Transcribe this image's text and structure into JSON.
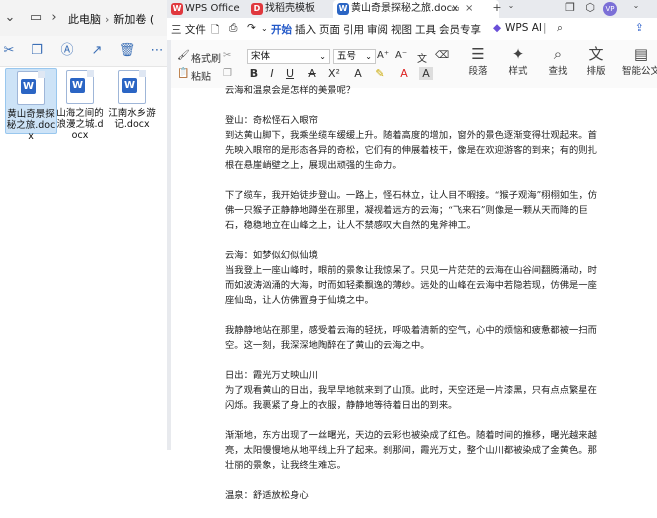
{
  "explorer": {
    "breadcrumb": [
      "此电脑",
      "新加卷 ("
    ],
    "files": [
      {
        "name": "黄山奇景探秘之旅.docx",
        "selected": true
      },
      {
        "name": "山海之间的浪漫之城.docx",
        "selected": false
      },
      {
        "name": "江南水乡游记.docx",
        "selected": false
      }
    ]
  },
  "tabs": {
    "wps": "WPS Office",
    "template": "找稻壳模板",
    "doc": "黄山奇景探秘之旅.docx"
  },
  "menu": {
    "file": "三 文件",
    "items": [
      "开始",
      "插入",
      "页面",
      "引用",
      "审阅",
      "视图",
      "工具",
      "会员专享"
    ],
    "ai": "WPS AI"
  },
  "ribbon": {
    "format_painter": "格式刷",
    "paste": "粘贴",
    "font": "宋体",
    "size": "五号",
    "paragraph": "段落",
    "styles": "样式",
    "find": "查找",
    "layout": "排版",
    "smart": "智能公文"
  },
  "doc": {
    "paragraphs": [
      "云海和温泉会是怎样的美景呢？",
      "登山：奇松怪石入眼帘\n到达黄山脚下，我乘坐缆车缓缓上升。随着高度的增加，窗外的景色逐渐变得壮观起来。首先映入眼帘的是形态各异的奇松，它们有的伸展着枝干，像是在欢迎游客的到来；有的则扎根在悬崖峭壁之上，展现出顽强的生命力。",
      "下了缆车，我开始徒步登山。一路上，怪石林立，让人目不暇接。“猴子观海”栩栩如生，仿佛一只猴子正静静地蹲坐在那里，凝视着远方的云海；“飞来石”则像是一颗从天而降的巨石，稳稳地立在山峰之上，让人不禁感叹大自然的鬼斧神工。",
      "云海：如梦似幻似仙境\n当我登上一座山峰时，眼前的景象让我惊呆了。只见一片茫茫的云海在山谷间翻腾涌动，时而如波涛汹涌的大海，时而如轻柔飘逸的薄纱。远处的山峰在云海中若隐若现，仿佛是一座座仙岛，让人仿佛置身于仙境之中。",
      "我静静地站在那里，感受着云海的轻抚，呼吸着清新的空气，心中的烦恼和疲惫都被一扫而空。这一刻，我深深地陶醉在了黄山的云海之中。",
      "日出：霞光万丈映山川\n为了观看黄山的日出，我早早地就来到了山顶。此时，天空还是一片漆黑，只有点点繁星在闪烁。我裹紧了身上的衣服，静静地等待着日出的到来。",
      "渐渐地，东方出现了一丝曙光，天边的云彩也被染成了红色。随着时间的推移，曙光越来越亮，太阳慢慢地从地平线上升了起来。刹那间，霞光万丈，整个山川都被染成了金黄色。那壮丽的景象，让我终生难忘。",
      "温泉：舒适放松身心"
    ]
  },
  "colors": {
    "accent": "#2258c8",
    "wps_red": "#e0383e",
    "word_blue": "#2b65c4"
  }
}
